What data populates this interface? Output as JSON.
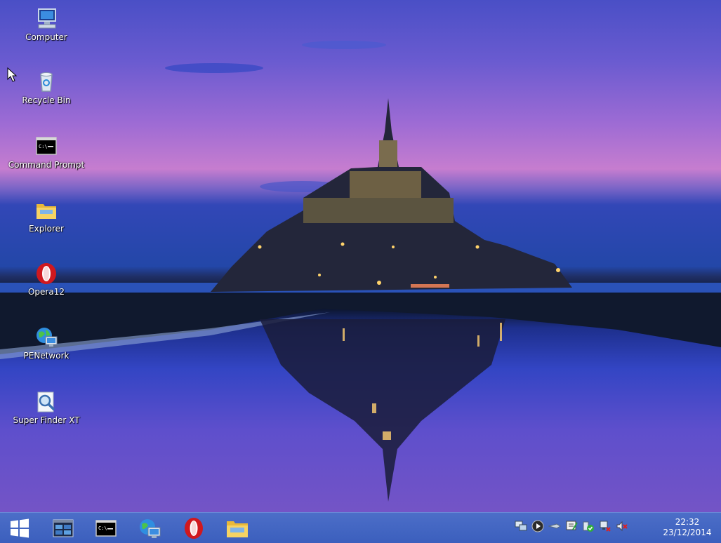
{
  "desktop": {
    "icons": [
      {
        "label": "Computer",
        "icon": "computer-icon"
      },
      {
        "label": "Recycle Bin",
        "icon": "recycle-bin-icon"
      },
      {
        "label": "Command Prompt",
        "icon": "command-prompt-icon"
      },
      {
        "label": "Explorer",
        "icon": "folder-icon"
      },
      {
        "label": "Opera12",
        "icon": "opera-icon"
      },
      {
        "label": "PENetwork",
        "icon": "network-globe-icon"
      },
      {
        "label": "Super Finder XT",
        "icon": "magnifier-search-icon"
      }
    ]
  },
  "taskbar": {
    "pinned": [
      {
        "icon": "windows-start-icon"
      },
      {
        "icon": "task-manager-icon"
      },
      {
        "icon": "command-prompt-icon"
      },
      {
        "icon": "network-globe-icon"
      },
      {
        "icon": "opera-icon"
      },
      {
        "icon": "folder-icon"
      }
    ],
    "tray": [
      "network-computer-icon",
      "media-play-icon",
      "usb-drive-icon",
      "keyboard-icon",
      "security-shield-icon",
      "network-disconnected-icon",
      "volume-muted-icon"
    ],
    "clock": {
      "time": "22:32",
      "date": "23/12/2014"
    }
  },
  "colors": {
    "taskbar": "#3b5fbd",
    "accent_opera": "#d0181e"
  }
}
